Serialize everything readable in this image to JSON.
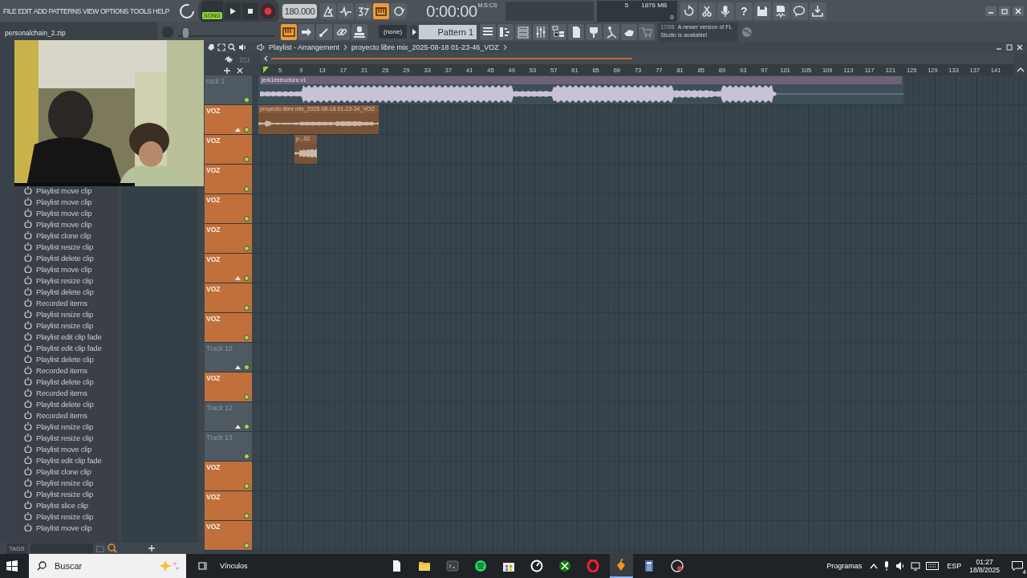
{
  "menu": [
    "FILE",
    "EDIT",
    "ADD",
    "PATTERNS",
    "VIEW",
    "OPTIONS",
    "TOOLS",
    "HELP"
  ],
  "transport": {
    "mode_label": "SONG",
    "song_selected": true,
    "tempo": "180.000",
    "time": "0:00:00",
    "time_unit": "M:S:CS"
  },
  "tools_top": [
    {
      "kind": "metronome",
      "on": false
    },
    {
      "kind": "wait",
      "on": false
    },
    {
      "kind": "countdown",
      "on": false
    },
    {
      "kind": "typing",
      "on": true
    },
    {
      "kind": "loop",
      "on": false
    }
  ],
  "monitor": {
    "cpu": "5",
    "memory": "1876 MB",
    "voices": "0"
  },
  "global_buttons": [
    {
      "kind": "undo"
    },
    {
      "kind": "cut"
    },
    {
      "kind": "mic"
    },
    {
      "kind": "help",
      "label": "?"
    },
    {
      "kind": "save"
    },
    {
      "kind": "render"
    },
    {
      "kind": "chat"
    },
    {
      "kind": "download"
    }
  ],
  "browser_path": "personalchain_2.zip",
  "tools_bottom": [
    {
      "kind": "snap",
      "on": true
    },
    {
      "kind": "arrow",
      "on": false
    },
    {
      "kind": "pencil",
      "on": false
    },
    {
      "kind": "link",
      "on": false
    },
    {
      "kind": "stamp",
      "on": false
    }
  ],
  "pattern": {
    "channel": "(none)",
    "name": "Pattern 1"
  },
  "windows": [
    {
      "kind": "playlist"
    },
    {
      "kind": "piano"
    },
    {
      "kind": "channel"
    },
    {
      "kind": "mixer"
    },
    {
      "kind": "browser"
    },
    {
      "kind": "project"
    },
    {
      "kind": "plugin"
    },
    {
      "kind": "touch"
    },
    {
      "kind": "mouse"
    },
    {
      "kind": "shop"
    }
  ],
  "pitch_slider": {
    "level": 0.05
  },
  "hint": {
    "date": "17/08",
    "message": "A newer version of FL Studio is available!"
  },
  "history": [
    {
      "label": "Playlist move clip"
    },
    {
      "label": "Playlist move clip"
    },
    {
      "label": "Playlist move clip"
    },
    {
      "label": "Playlist move clip"
    },
    {
      "label": "Playlist clone clip"
    },
    {
      "label": "Playlist resize clip"
    },
    {
      "label": "Playlist delete clip"
    },
    {
      "label": "Playlist move clip"
    },
    {
      "label": "Playlist resize clip"
    },
    {
      "label": "Playlist delete clip"
    },
    {
      "label": "Recorded items"
    },
    {
      "label": "Playlist resize clip"
    },
    {
      "label": "Playlist resize clip"
    },
    {
      "label": "Playlist edit clip fade"
    },
    {
      "label": "Playlist edit clip fade"
    },
    {
      "label": "Playlist delete clip"
    },
    {
      "label": "Recorded items"
    },
    {
      "label": "Playlist delete clip"
    },
    {
      "label": "Recorded items"
    },
    {
      "label": "Playlist delete clip"
    },
    {
      "label": "Recorded items"
    },
    {
      "label": "Playlist resize clip"
    },
    {
      "label": "Playlist resize clip"
    },
    {
      "label": "Playlist move clip"
    },
    {
      "label": "Playlist edit clip fade"
    },
    {
      "label": "Playlist clone clip"
    },
    {
      "label": "Playlist resize clip"
    },
    {
      "label": "Playlist resize clip"
    },
    {
      "label": "Playlist slice clip"
    },
    {
      "label": "Playlist resize clip"
    },
    {
      "label": "Playlist move clip"
    }
  ],
  "tags_label": "TAGS",
  "playlist": {
    "title": "Playlist - Arrangement",
    "project": "proyecto libre mix_2025-08-18 01-23-46_VOZ",
    "ruler": [
      "5",
      "9",
      "13",
      "17",
      "21",
      "25",
      "29",
      "33",
      "37",
      "41",
      "45",
      "49",
      "53",
      "57",
      "61",
      "65",
      "69",
      "73",
      "77",
      "81",
      "85",
      "89",
      "93",
      "97",
      "101",
      "105",
      "109",
      "113",
      "117",
      "121",
      "125",
      "129",
      "133",
      "137",
      "141"
    ],
    "tracks": [
      {
        "name": "rack 1",
        "color": "#4e5961",
        "arrow": false,
        "clips": [
          {
            "name": "jerk1estructura v1",
            "kind": "song"
          }
        ]
      },
      {
        "name": "VOZ",
        "color": "#c1703c",
        "arrow": true,
        "clips": [
          {
            "name": "proyecto libre mix_2025-08-18 01-23-34_VOZ",
            "kind": "voice"
          }
        ]
      },
      {
        "name": "VOZ",
        "color": "#c1703c",
        "arrow": false,
        "clips": [
          {
            "name": "p...02",
            "kind": "short"
          }
        ]
      },
      {
        "name": "VOZ",
        "color": "#c1703c",
        "arrow": false
      },
      {
        "name": "VOZ",
        "color": "#c1703c",
        "arrow": false
      },
      {
        "name": "VOZ",
        "color": "#c1703c",
        "arrow": false
      },
      {
        "name": "VOZ",
        "color": "#c1703c",
        "arrow": true
      },
      {
        "name": "VOZ",
        "color": "#c1703c",
        "arrow": false
      },
      {
        "name": "VOZ",
        "color": "#c1703c",
        "arrow": false
      },
      {
        "name": "Track 10",
        "color": "#4e5961",
        "arrow": true
      },
      {
        "name": "VOZ",
        "color": "#c1703c",
        "arrow": false
      },
      {
        "name": "Track 12",
        "color": "#4e5961",
        "arrow": true
      },
      {
        "name": "Track 13",
        "color": "#4e5961",
        "arrow": false
      },
      {
        "name": "VOZ",
        "color": "#c1703c",
        "arrow": false
      },
      {
        "name": "VOZ",
        "color": "#c1703c",
        "arrow": false
      },
      {
        "name": "VOZ",
        "color": "#c1703c",
        "arrow": false
      }
    ]
  },
  "taskbar": {
    "search": "Buscar",
    "links": "Vínculos",
    "apps": [
      {
        "kind": "file"
      },
      {
        "kind": "folder"
      },
      {
        "kind": "terminal"
      },
      {
        "kind": "music"
      },
      {
        "kind": "store"
      },
      {
        "kind": "clock"
      },
      {
        "kind": "xbox"
      },
      {
        "kind": "browser"
      },
      {
        "kind": "daw",
        "selected": true
      },
      {
        "kind": "calculator"
      },
      {
        "kind": "disk"
      }
    ],
    "programs": "Programas",
    "language": "ESP",
    "time": "01:27",
    "date": "18/8/2025",
    "notifications": "4"
  }
}
